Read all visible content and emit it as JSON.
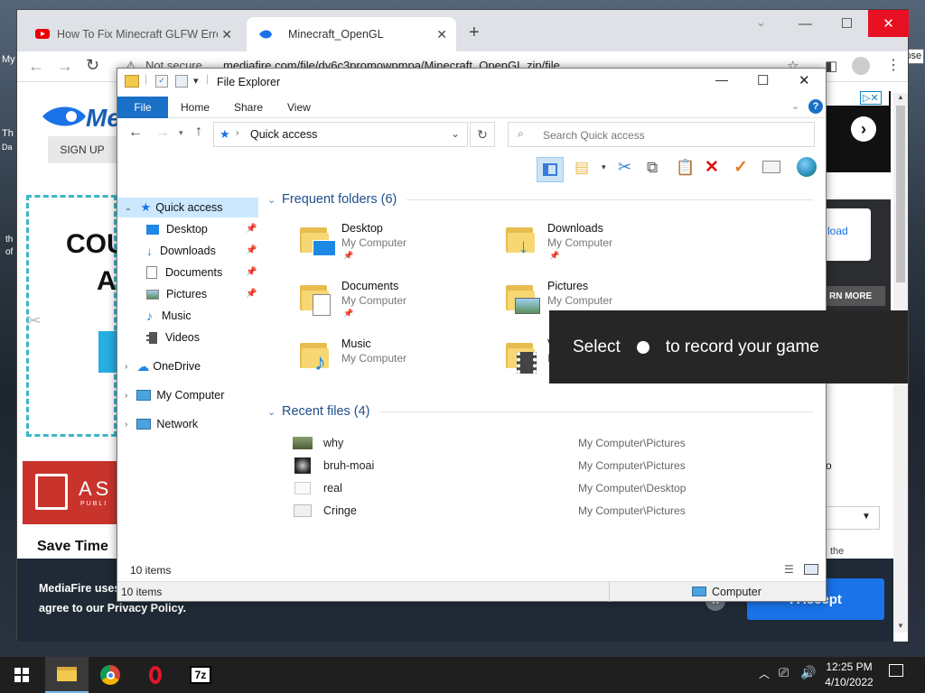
{
  "desktop": {
    "left_texts": [
      "My",
      "Th",
      "Da",
      "th",
      "of"
    ],
    "close_tooltip": "Close"
  },
  "browser": {
    "tabs": [
      {
        "title": "How To Fix Minecraft GLFW Error"
      },
      {
        "title": "Minecraft_OpenGL"
      }
    ],
    "address": {
      "security": "Not secure",
      "url": "mediafire.com/file/dy6c3promowpmpa/Minecraft_OpenGL.zip/file"
    },
    "page": {
      "logo": "Me",
      "signup": "SIGN UP",
      "promo_line1": "COU",
      "promo_line2": "A",
      "asp_text": "AS",
      "asp_sub": "PUBLI",
      "save_time": "Save Time",
      "load_text": "load",
      "learn_more": "RN MORE",
      "the_text": "the",
      "o_text": "o",
      "cookie_text_1": "MediaFire uses",
      "cookie_text_2": "agree to our Privacy Policy.",
      "accept": "I Accept"
    }
  },
  "explorer": {
    "title": "File Explorer",
    "ribbon_tabs": [
      "File",
      "Home",
      "Share",
      "View"
    ],
    "breadcrumb": "Quick access",
    "search_placeholder": "Search Quick access",
    "nav_pane": {
      "quick_access": "Quick access",
      "pinned": [
        "Desktop",
        "Downloads",
        "Documents",
        "Pictures"
      ],
      "unpinned": [
        "Music",
        "Videos"
      ],
      "roots": [
        "OneDrive",
        "My Computer",
        "Network"
      ]
    },
    "frequent_header": "Frequent folders (6)",
    "frequent": [
      {
        "name": "Desktop",
        "location": "My Computer"
      },
      {
        "name": "Downloads",
        "location": "My Computer"
      },
      {
        "name": "Documents",
        "location": "My Computer"
      },
      {
        "name": "Pictures",
        "location": "My Computer"
      },
      {
        "name": "Music",
        "location": "My Computer"
      },
      {
        "name": "V",
        "location": "M"
      }
    ],
    "recent_header": "Recent files (4)",
    "recent": [
      {
        "name": "why",
        "path": "My Computer\\Pictures"
      },
      {
        "name": "bruh-moai",
        "path": "My Computer\\Pictures"
      },
      {
        "name": "real",
        "path": "My Computer\\Desktop"
      },
      {
        "name": "Cringe",
        "path": "My Computer\\Pictures"
      }
    ],
    "item_count": "10 items",
    "status_count": "10 items",
    "status_location": "Computer"
  },
  "gamebar": {
    "before": "Select",
    "after": "to record your game"
  },
  "taskbar": {
    "time": "12:25 PM",
    "date": "4/10/2022"
  }
}
